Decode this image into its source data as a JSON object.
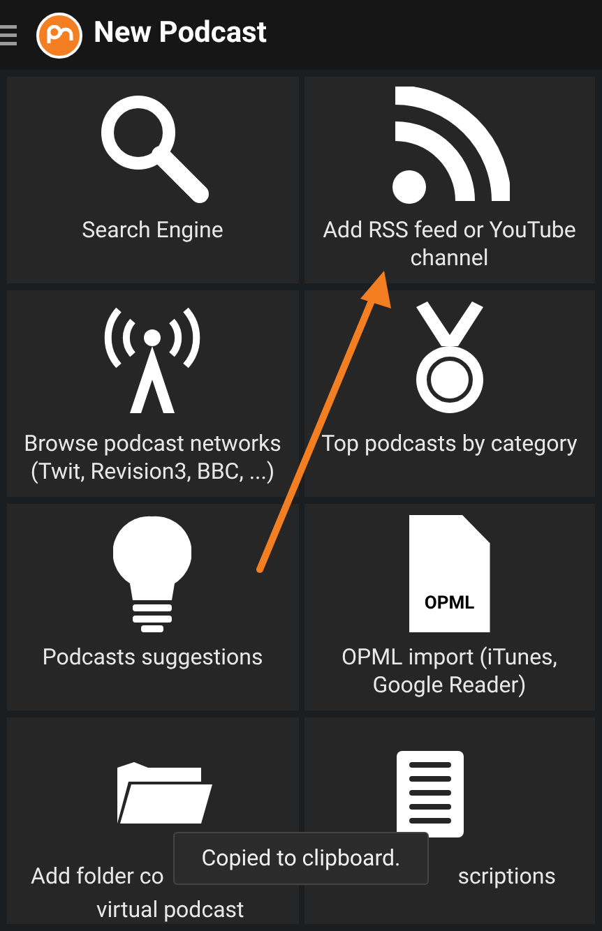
{
  "app_bar": {
    "title": "New Podcast"
  },
  "tiles": [
    {
      "kind": "search",
      "lines": [
        "Search Engine"
      ]
    },
    {
      "kind": "rss",
      "lines": [
        "Add RSS feed or YouTube",
        "channel"
      ]
    },
    {
      "kind": "tower",
      "lines": [
        "Browse podcast networks",
        "(Twit, Revision3, BBC, ...)"
      ]
    },
    {
      "kind": "medal",
      "lines": [
        "Top podcasts by category"
      ]
    },
    {
      "kind": "bulb",
      "lines": [
        "Podcasts suggestions"
      ]
    },
    {
      "kind": "opml",
      "badge": "OPML",
      "lines": [
        "OPML import (iTunes,",
        "Google Reader)"
      ]
    },
    {
      "kind": "folder",
      "lines": [
        "Add folder co",
        "virtual podcast"
      ]
    },
    {
      "kind": "list",
      "lines": [
        "scriptions"
      ]
    }
  ],
  "toast": "Copied to clipboard."
}
